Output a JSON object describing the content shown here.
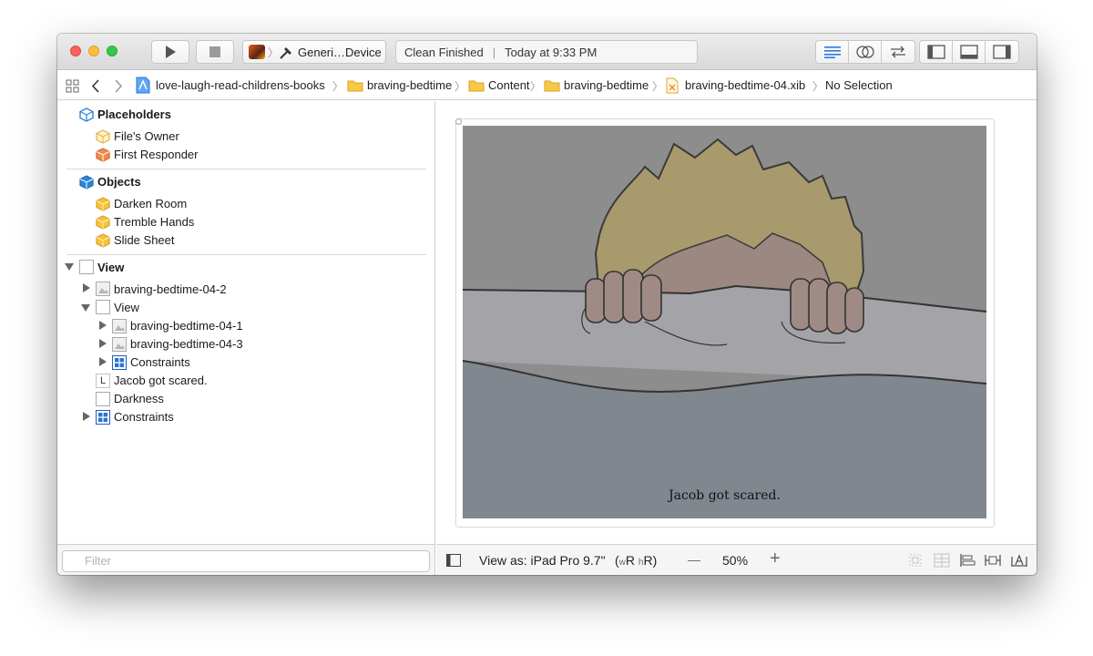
{
  "toolbar": {
    "scheme_label": "Generi…Device",
    "status_message": "Clean Finished",
    "status_time": "Today at 9:33 PM",
    "traffic_colors": [
      "#fc605b",
      "#fdbc40",
      "#34c84a"
    ]
  },
  "jumpbar": {
    "crumbs": [
      "love-laugh-read-childrens-books",
      "braving-bedtime",
      "Content",
      "braving-bedtime",
      "braving-bedtime-04.xib",
      "No Selection"
    ]
  },
  "outline": {
    "placeholders": {
      "title": "Placeholders",
      "items": [
        "File's Owner",
        "First Responder"
      ]
    },
    "objects": {
      "title": "Objects",
      "items": [
        "Darken Room",
        "Tremble Hands",
        "Slide Sheet"
      ]
    },
    "tree": {
      "root": "View",
      "nodes": [
        {
          "label": "braving-bedtime-04-2",
          "icon": "image-view-icon"
        },
        {
          "label": "View",
          "icon": "view-icon"
        },
        {
          "label": "braving-bedtime-04-1",
          "icon": "image-view-icon"
        },
        {
          "label": "braving-bedtime-04-3",
          "icon": "image-view-icon"
        },
        {
          "label": "Constraints",
          "icon": "constraints-icon"
        },
        {
          "label": "Jacob got scared.",
          "icon": "label-icon",
          "badge": "L"
        },
        {
          "label": "Darkness",
          "icon": "view-icon"
        },
        {
          "label": "Constraints",
          "icon": "constraints-icon"
        }
      ]
    },
    "filter_placeholder": "Filter"
  },
  "canvas": {
    "caption": "Jacob got scared."
  },
  "bottombar": {
    "view_as": "View as: iPad Pro 9.7\"",
    "size_class_w": "w",
    "size_class_w_value": "R",
    "size_class_h": "h",
    "size_class_h_value": "R",
    "zoom_minus": "—",
    "zoom": "50%",
    "zoom_plus": "+"
  }
}
